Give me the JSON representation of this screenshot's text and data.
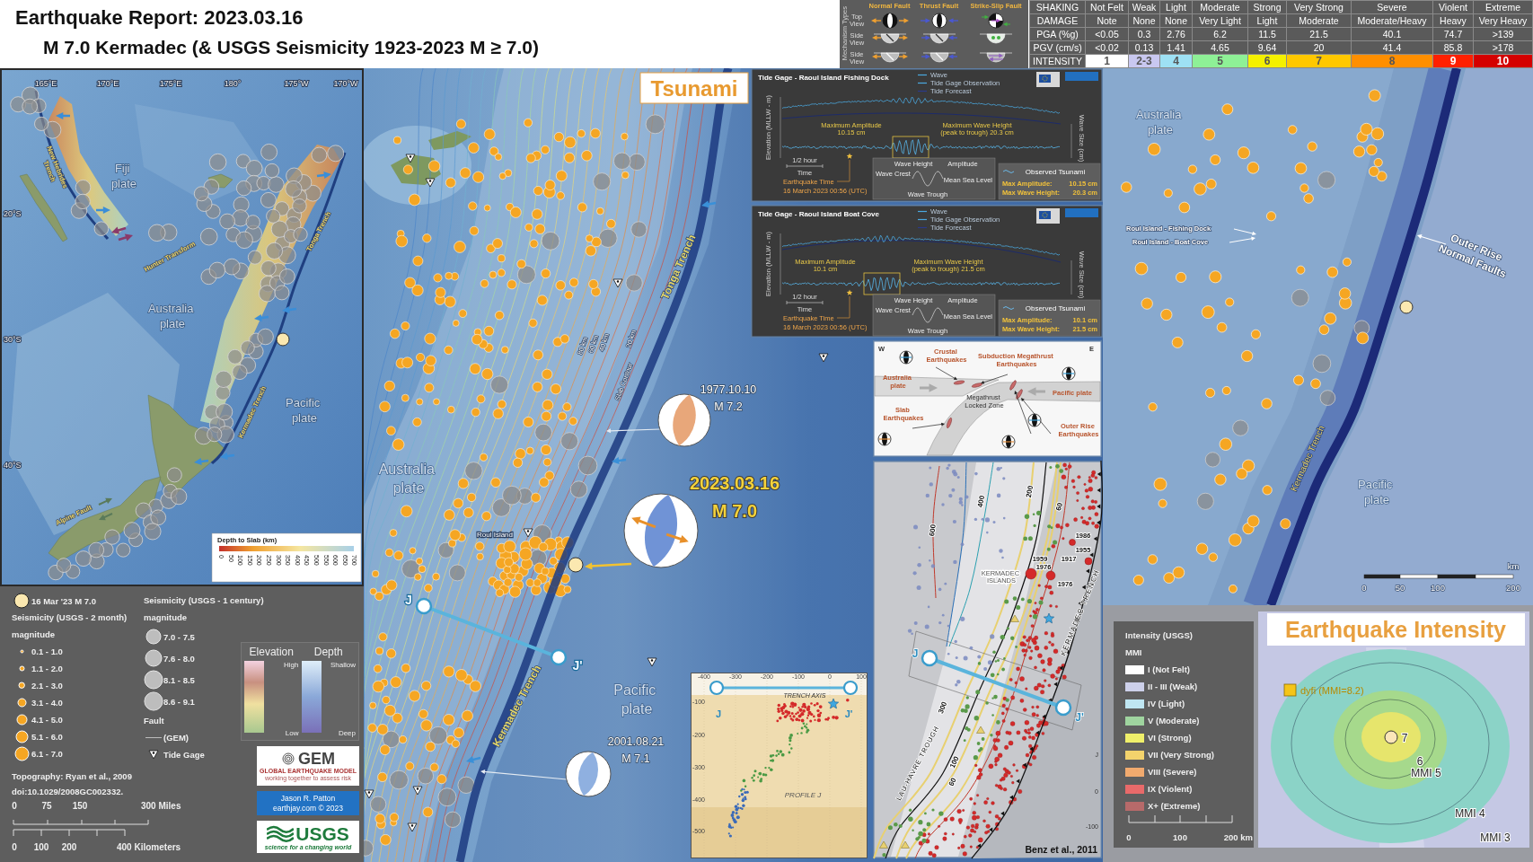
{
  "header": {
    "title": "Earthquake Report: 2023.03.16",
    "subtitle": "M 7.0 Kermadec (& USGS Seismicity 1923-2023 M ≥ 7.0)"
  },
  "mechanism_types": {
    "title": "Mechanism Types",
    "faults": [
      {
        "label": "Normal Fault",
        "kind": "normal"
      },
      {
        "label": "Thrust Fault",
        "kind": "thrust"
      },
      {
        "label": "Strike-Slip Fault",
        "kind": "strike-slip"
      }
    ],
    "views": [
      {
        "label": "Top View",
        "kind": "plan"
      },
      {
        "label": "Side View",
        "kind": "hemisphere"
      },
      {
        "label": "Side View",
        "kind": "block"
      }
    ]
  },
  "intensity_scale": {
    "rows": [
      {
        "label": "SHAKING",
        "cells": [
          "Not Felt",
          "Weak",
          "Light",
          "Moderate",
          "Strong",
          "Very Strong",
          "Severe",
          "Violent",
          "Extreme"
        ]
      },
      {
        "label": "DAMAGE",
        "cells": [
          "Note",
          "None",
          "None",
          "Very Light",
          "Light",
          "Moderate",
          "Moderate/Heavy",
          "Heavy",
          "Very Heavy"
        ]
      },
      {
        "label": "PGA (%g)",
        "cells": [
          "<0.05",
          "0.3",
          "2.76",
          "6.2",
          "11.5",
          "21.5",
          "40.1",
          "74.7",
          ">139"
        ]
      },
      {
        "label": "PGV (cm/s)",
        "cells": [
          "<0.02",
          "0.13",
          "1.41",
          "4.65",
          "9.64",
          "20",
          "41.4",
          "85.8",
          ">178"
        ]
      }
    ],
    "intensity": {
      "label": "INTENSITY",
      "levels": [
        {
          "text": "1",
          "color": "#ffffff"
        },
        {
          "text": "2-3",
          "color": "#c9c8f0"
        },
        {
          "text": "4",
          "color": "#9ee1f4"
        },
        {
          "text": "5",
          "color": "#8ef096"
        },
        {
          "text": "6",
          "color": "#f4f000"
        },
        {
          "text": "7",
          "color": "#ffc800"
        },
        {
          "text": "8",
          "color": "#ff8f00"
        },
        {
          "text": "9",
          "color": "#ff2000"
        },
        {
          "text": "10",
          "color": "#d40000"
        }
      ]
    }
  },
  "regional_map": {
    "longitudes": [
      "165°E",
      "170°E",
      "175°E",
      "180°",
      "175°W",
      "170°W"
    ],
    "latitudes": [
      "20°S",
      "30°S",
      "40°S"
    ],
    "labels": [
      {
        "text": "Fiji plate",
        "kind": "plate"
      },
      {
        "text": "New Hebrides Trench",
        "kind": "fault"
      },
      {
        "text": "Hunter Transform",
        "kind": "fault"
      },
      {
        "text": "Tonga Trench",
        "kind": "fault"
      },
      {
        "text": "Australia plate",
        "kind": "plate"
      },
      {
        "text": "Pacific plate",
        "kind": "plate"
      },
      {
        "text": "Kermadec Trench",
        "kind": "fault"
      },
      {
        "text": "Alpine Fault",
        "kind": "fault"
      }
    ],
    "slab_legend": {
      "title": "Depth to Slab (km)",
      "ticks": [
        "0",
        "50",
        "100",
        "150",
        "200",
        "250",
        "300",
        "350",
        "400",
        "450",
        "500",
        "550",
        "600",
        "650",
        "700"
      ]
    }
  },
  "legend": {
    "epicenter": "16 Mar '23 M 7.0",
    "recent": {
      "title": "Seismicity (USGS - 2 month)",
      "subtitle": "magnitude",
      "classes": [
        "0.1 - 1.0",
        "1.1 - 2.0",
        "2.1 - 3.0",
        "3.1 - 4.0",
        "4.1 - 5.0",
        "5.1 - 6.0",
        "6.1 - 7.0"
      ]
    },
    "century": {
      "title": "Seismicity (USGS - 1 century)",
      "subtitle": "magnitude",
      "classes": [
        "7.0 - 7.5",
        "7.6 - 8.0",
        "8.1 - 8.5",
        "8.6 - 9.1"
      ]
    },
    "fault": {
      "title": "Fault",
      "label": "(GEM)"
    },
    "tide_gage": "Tide Gage",
    "elevation": {
      "title": "Elevation",
      "high": "High",
      "low": "Low"
    },
    "depth": {
      "title": "Depth",
      "high": "Shallow",
      "low": "Deep"
    },
    "credits": [
      "Topography: Ryan et al., 2009",
      "doi:10.1029/2008GC002332."
    ],
    "miles": [
      "0",
      "75",
      "150",
      "300 Miles"
    ],
    "kilometers": [
      "0",
      "100",
      "200",
      "400 Kilometers"
    ],
    "logos": {
      "gem": {
        "name": "GEM",
        "line1": "GLOBAL EARTHQUAKE MODEL",
        "line2": "working together to assess risk"
      },
      "author": {
        "name": "Jason R. Patton",
        "site": "earthjay.com © 2023"
      },
      "usgs": {
        "name": "USGS",
        "tagline": "science for a changing world"
      }
    }
  },
  "main_map": {
    "title": "Tsunami",
    "labels": [
      {
        "text": "Australia plate",
        "kind": "plate"
      },
      {
        "text": "Pacific plate",
        "kind": "plate"
      },
      {
        "text": "Tonga Trench",
        "kind": "trench"
      },
      {
        "text": "Kermadec Trench",
        "kind": "trench"
      },
      {
        "text": "Roul Island",
        "kind": "place"
      },
      {
        "text": "80 km",
        "kind": "contour"
      },
      {
        "text": "60 km",
        "kind": "contour"
      },
      {
        "text": "40 km",
        "kind": "contour"
      },
      {
        "text": "20 km",
        "kind": "contour"
      },
      {
        "text": "Slab Contour",
        "kind": "contour"
      }
    ],
    "events": [
      {
        "date": "1977.10.10",
        "magnitude": "M 7.2",
        "kind": "historic",
        "color": "#e8a77a"
      },
      {
        "date": "2023.03.16",
        "magnitude": "M 7.0",
        "kind": "mainshock",
        "color": "#7093d6"
      },
      {
        "date": "2001.08.21",
        "magnitude": "M 7.1",
        "kind": "historic",
        "color": "#8fb0e0"
      }
    ],
    "profile": {
      "start": "J",
      "end": "J'"
    }
  },
  "tide_gages": [
    {
      "title": "Tide Gage - Raoul Island Fishing Dock",
      "legend": [
        "Wave",
        "Tide Gage Observation",
        "Tide Forecast"
      ],
      "y_label": "Elevation (MLLW - m)",
      "y2_label": "Wave Size (cm)",
      "amplitude_label": "Maximum Amplitude",
      "amplitude": "10.15 cm",
      "height_label": "Maximum Wave Height",
      "height": "(peak to trough) 20.3 cm",
      "time_scale": "1/2 hour",
      "time_label": "Time",
      "quake_label": "Earthquake Time",
      "quake_time": "16 March 2023 00:56 (UTC)",
      "diagram": [
        "Wave Height",
        "Amplitude",
        "Wave Crest",
        "Mean Sea Level",
        "Wave Trough"
      ],
      "summary": {
        "title": "Observed Tsunami",
        "rows": [
          {
            "label": "Max Amplitude:",
            "value": "10.15 cm"
          },
          {
            "label": "Max Wave Height:",
            "value": "20.3 cm"
          }
        ]
      }
    },
    {
      "title": "Tide Gage - Raoul Island Boat Cove",
      "legend": [
        "Wave",
        "Tide Gage Observation",
        "Tide Forecast"
      ],
      "y_label": "Elevation (MLLW - m)",
      "y2_label": "Wave Size (cm)",
      "amplitude_label": "Maximum Amplitude",
      "amplitude": "10.1 cm",
      "height_label": "Maximum Wave Height",
      "height": "(peak to trough) 21.5 cm",
      "time_scale": "1/2 hour",
      "time_label": "Time",
      "quake_label": "Earthquake Time",
      "quake_time": "16 March 2023 00:56 (UTC)",
      "diagram": [
        "Wave Height",
        "Amplitude",
        "Wave Crest",
        "Mean Sea Level",
        "Wave Trough"
      ],
      "summary": {
        "title": "Observed Tsunami",
        "rows": [
          {
            "label": "Max Amplitude:",
            "value": "10.1 cm"
          },
          {
            "label": "Max Wave Height:",
            "value": "21.5 cm"
          }
        ]
      }
    }
  ],
  "tectonic_schematic": {
    "west": "W",
    "east": "E",
    "labels": [
      {
        "text": "Crustal Earthquakes",
        "kind": "quake"
      },
      {
        "text": "Subduction Megathrust Earthquakes",
        "kind": "quake"
      },
      {
        "text": "Australia plate",
        "kind": "plate"
      },
      {
        "text": "Pacific plate",
        "kind": "plate"
      },
      {
        "text": "Megathrust Locked Zone",
        "kind": "zone"
      },
      {
        "text": "Slab Earthquakes",
        "kind": "quake"
      },
      {
        "text": "Outer Rise Earthquakes",
        "kind": "quake"
      }
    ]
  },
  "seismicity_map": {
    "contours": [
      "600",
      "400",
      "200",
      "60",
      "300",
      "100",
      "60"
    ],
    "years": [
      "1986",
      "1955",
      "1959",
      "1917",
      "1976",
      "1976"
    ],
    "labels": [
      {
        "text": "KERMADEC ISLANDS",
        "kind": "islands"
      },
      {
        "text": "KERMADEC TRENCH",
        "kind": "trench"
      },
      {
        "text": "LAU-HAVRE TROUGH",
        "kind": "trough"
      }
    ],
    "profile": {
      "start": "J",
      "end": "J'"
    },
    "axis": [
      "J",
      "0",
      "-100"
    ],
    "credit": "Benz et al., 2011"
  },
  "profile_inset": {
    "x_ticks": [
      "-400",
      "-300",
      "-200",
      "-100",
      "0",
      "100"
    ],
    "y_ticks": [
      "-100",
      "-200",
      "-300",
      "-400",
      "-500"
    ],
    "trench": "TRENCH AXIS",
    "start": "J",
    "end": "J'",
    "title": "PROFILE J"
  },
  "detail_map": {
    "labels": [
      {
        "text": "Australia plate",
        "kind": "plate"
      },
      {
        "text": "Roul Island - Fishing Dock",
        "kind": "gage"
      },
      {
        "text": "Roul Island - Boat Cove",
        "kind": "gage"
      },
      {
        "text": "Outer Rise Normal Faults",
        "kind": "feature"
      },
      {
        "text": "Kermadec Trench",
        "kind": "trench"
      },
      {
        "text": "Pacific plate",
        "kind": "plate"
      }
    ],
    "scale": {
      "unit": "km",
      "ticks": [
        "0",
        "50",
        "100",
        "200"
      ]
    }
  },
  "intensity_map": {
    "legend": {
      "title": "Intensity (USGS)",
      "subtitle": "MMI",
      "classes": [
        {
          "label": "I (Not Felt)",
          "color": "#ffffff"
        },
        {
          "label": "II - III (Weak)",
          "color": "#cdd0ea"
        },
        {
          "label": "IV (Light)",
          "color": "#bfe6f2"
        },
        {
          "label": "V (Moderate)",
          "color": "#9fd49f"
        },
        {
          "label": "VI (Strong)",
          "color": "#efef6a"
        },
        {
          "label": "VII (Very Strong)",
          "color": "#f3d36c"
        },
        {
          "label": "VIII (Severe)",
          "color": "#f1aa6e"
        },
        {
          "label": "IX (Violent)",
          "color": "#e86a6a"
        },
        {
          "label": "X+ (Extreme)",
          "color": "#b76a6a"
        }
      ],
      "scale": [
        "0",
        "100",
        "200 km"
      ]
    },
    "title": "Earthquake Intensity",
    "dyfi": "dyfi (MMI=8.2)",
    "contours": [
      "7",
      "6",
      "MMI 5",
      "MMI 4",
      "MMI 3"
    ]
  }
}
